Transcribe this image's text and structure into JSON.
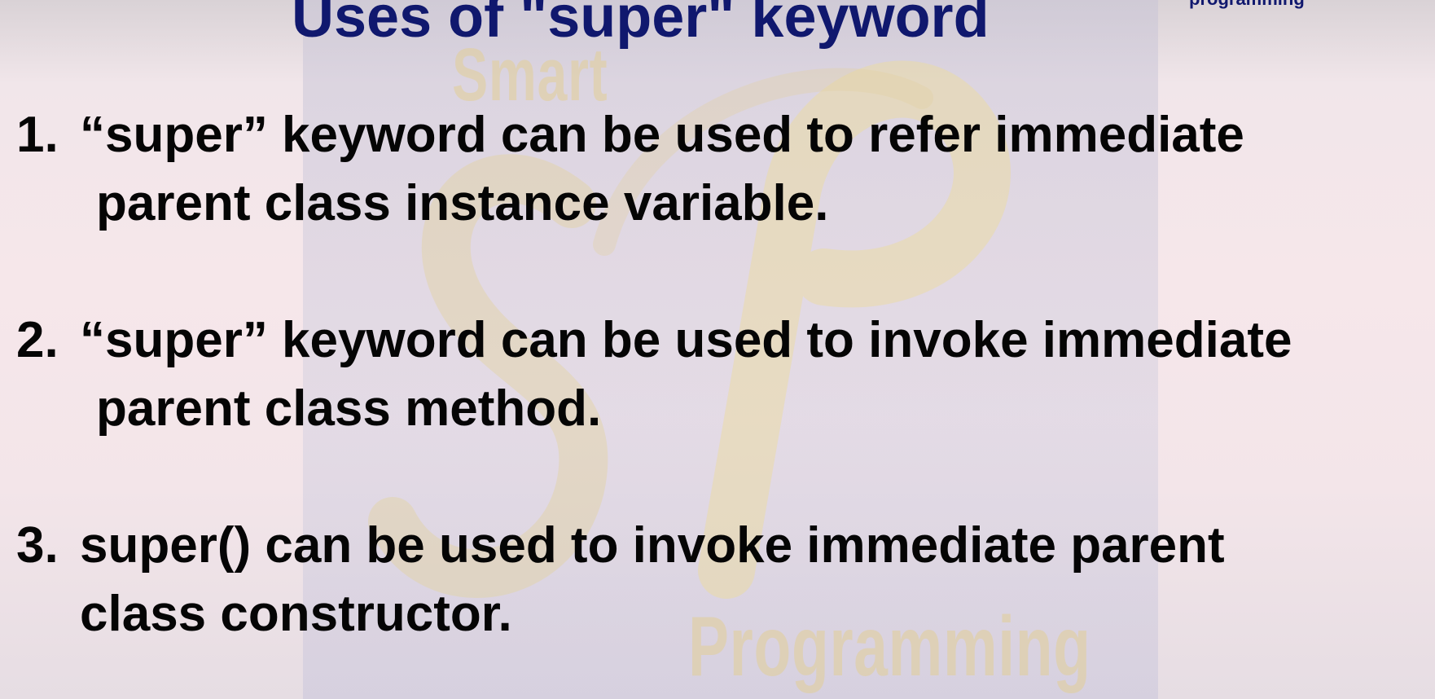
{
  "slide": {
    "title": "Uses of \"super\" keyword",
    "corner_text": "programming",
    "watermark": {
      "top_word": "Smart",
      "logo_letters": "SP",
      "bottom_word": "Programming"
    },
    "points": [
      {
        "number": "1.",
        "line1": "“super” keyword can be used to refer immediate",
        "line2": "parent class instance variable."
      },
      {
        "number": "2.",
        "line1": "“super” keyword can be used to invoke immediate",
        "line2": "parent class method."
      },
      {
        "number": "3.",
        "line1": "super() can be used to invoke immediate parent",
        "line2": "class constructor."
      }
    ]
  }
}
